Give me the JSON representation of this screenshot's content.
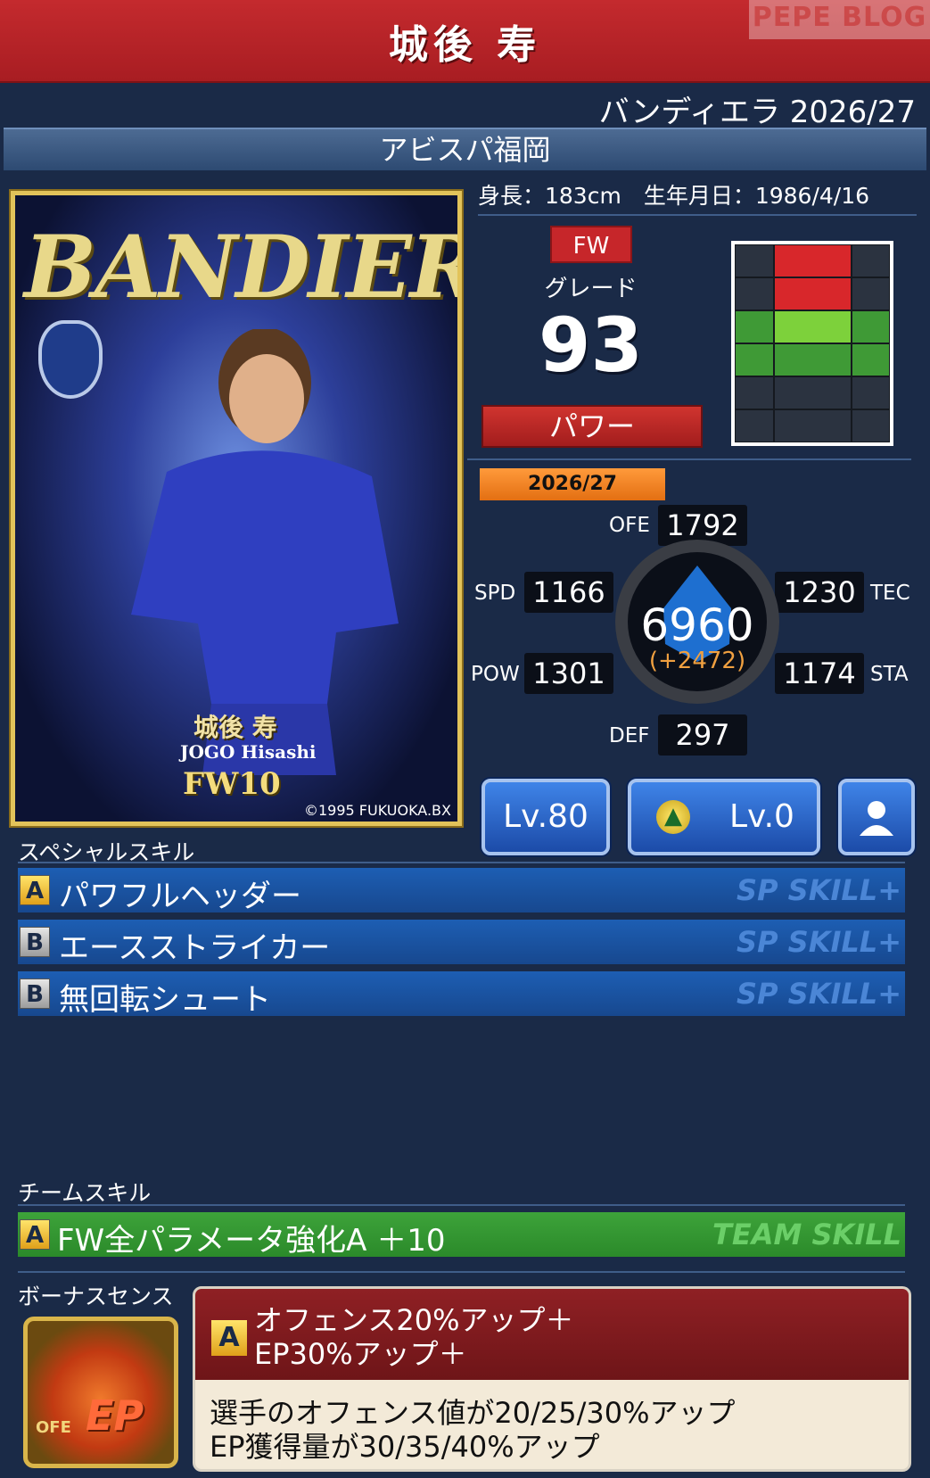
{
  "header": {
    "title": "城後 寿",
    "watermark": "PEPE BLOG"
  },
  "edition": "バンディエラ 2026/27",
  "club": "アビスパ福岡",
  "card": {
    "banner": "BANDIERA",
    "name_jp": "城後 寿",
    "name_en": "JOGO Hisashi",
    "position_number": "FW10",
    "copyright": "©1995 FUKUOKA.BX"
  },
  "profile": {
    "height_weight": "身長：183cm　生年月日：1986/4/16"
  },
  "position_badge": "FW",
  "grade": {
    "label": "グレード",
    "value": "93"
  },
  "type_label": "パワー",
  "season": "2026/27",
  "stats": {
    "ofe": {
      "label": "OFE",
      "value": "1792"
    },
    "spd": {
      "label": "SPD",
      "value": "1166"
    },
    "tec": {
      "label": "TEC",
      "value": "1230"
    },
    "pow": {
      "label": "POW",
      "value": "1301"
    },
    "sta": {
      "label": "STA",
      "value": "1174"
    },
    "def": {
      "label": "DEF",
      "value": "297"
    },
    "total": "6960",
    "delta": "(+2472)"
  },
  "buttons": {
    "level": "Lv.80",
    "sub_level": "Lv.0"
  },
  "special_skills": {
    "title": "スペシャルスキル",
    "items": [
      {
        "rank": "A",
        "name": "パワフルヘッダー",
        "tag": "SP SKILL+"
      },
      {
        "rank": "B",
        "name": "エースストライカー",
        "tag": "SP SKILL+"
      },
      {
        "rank": "B",
        "name": "無回転シュート",
        "tag": "SP SKILL+"
      }
    ]
  },
  "team_skill": {
    "title": "チームスキル",
    "rank": "A",
    "name": "FW全パラメータ強化A ＋10",
    "tag": "TEAM SKILL"
  },
  "bonus": {
    "title": "ボーナスセンス",
    "icon_ep": "EP",
    "icon_ofe": "OFE",
    "rank": "A",
    "name_line1": "オフェンス20%アップ＋",
    "name_line2": "EP30%アップ＋",
    "desc_line1": "選手のオフェンス値が20/25/30%アップ",
    "desc_line2": "EP獲得量が30/35/40%アップ"
  },
  "colors": {
    "accent_red": "#c42a2e",
    "skill_blue": "#1d5eb3",
    "team_green": "#3da33a",
    "season_orange": "#ff9a3b"
  }
}
